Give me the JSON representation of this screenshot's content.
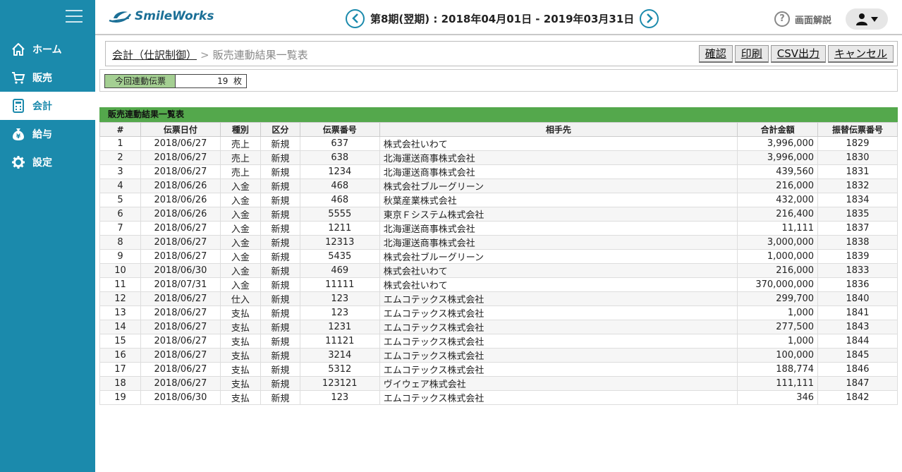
{
  "app": {
    "logo_text": "SmileWorks"
  },
  "header": {
    "period": "第8期(翌期) : 2018年04月01日 - 2019年03月31日",
    "help_label": "画面解説",
    "help_mark": "?"
  },
  "sidebar": {
    "items": [
      {
        "label": "ホーム",
        "icon": "home-icon"
      },
      {
        "label": "販売",
        "icon": "cart-icon"
      },
      {
        "label": "会計",
        "icon": "calculator-icon",
        "active": true
      },
      {
        "label": "給与",
        "icon": "yen-bag-icon"
      },
      {
        "label": "設定",
        "icon": "gear-icon"
      }
    ]
  },
  "breadcrumb": {
    "parent": "会計（仕訳制御）",
    "separator": ">",
    "current": "販売連動結果一覧表"
  },
  "toolbar": {
    "confirm": "確認",
    "print": "印刷",
    "csv": "CSV出力",
    "cancel": "キャンセル"
  },
  "count": {
    "label": "今回連動伝票",
    "value": "19",
    "unit": "枚"
  },
  "table": {
    "title": "販売連動結果一覧表",
    "headers": [
      "#",
      "伝票日付",
      "種別",
      "区分",
      "伝票番号",
      "相手先",
      "合計金額",
      "振替伝票番号"
    ],
    "rows": [
      [
        "1",
        "2018/06/27",
        "売上",
        "新規",
        "637",
        "株式会社いわて",
        "3,996,000",
        "1829"
      ],
      [
        "2",
        "2018/06/27",
        "売上",
        "新規",
        "638",
        "北海運送商事株式会社",
        "3,996,000",
        "1830"
      ],
      [
        "3",
        "2018/06/27",
        "売上",
        "新規",
        "1234",
        "北海運送商事株式会社",
        "439,560",
        "1831"
      ],
      [
        "4",
        "2018/06/26",
        "入金",
        "新規",
        "468",
        "株式会社ブルーグリーン",
        "216,000",
        "1832"
      ],
      [
        "5",
        "2018/06/26",
        "入金",
        "新規",
        "468",
        "秋葉産業株式会社",
        "432,000",
        "1834"
      ],
      [
        "6",
        "2018/06/26",
        "入金",
        "新規",
        "5555",
        "東京Ｆシステム株式会社",
        "216,400",
        "1835"
      ],
      [
        "7",
        "2018/06/27",
        "入金",
        "新規",
        "1211",
        "北海運送商事株式会社",
        "11,111",
        "1837"
      ],
      [
        "8",
        "2018/06/27",
        "入金",
        "新規",
        "12313",
        "北海運送商事株式会社",
        "3,000,000",
        "1838"
      ],
      [
        "9",
        "2018/06/27",
        "入金",
        "新規",
        "5435",
        "株式会社ブルーグリーン",
        "1,000,000",
        "1839"
      ],
      [
        "10",
        "2018/06/30",
        "入金",
        "新規",
        "469",
        "株式会社いわて",
        "216,000",
        "1833"
      ],
      [
        "11",
        "2018/07/31",
        "入金",
        "新規",
        "11111",
        "株式会社いわて",
        "370,000,000",
        "1836"
      ],
      [
        "12",
        "2018/06/27",
        "仕入",
        "新規",
        "123",
        "エムコテックス株式会社",
        "299,700",
        "1840"
      ],
      [
        "13",
        "2018/06/27",
        "支払",
        "新規",
        "123",
        "エムコテックス株式会社",
        "1,000",
        "1841"
      ],
      [
        "14",
        "2018/06/27",
        "支払",
        "新規",
        "1231",
        "エムコテックス株式会社",
        "277,500",
        "1843"
      ],
      [
        "15",
        "2018/06/27",
        "支払",
        "新規",
        "11121",
        "エムコテックス株式会社",
        "1,000",
        "1844"
      ],
      [
        "16",
        "2018/06/27",
        "支払",
        "新規",
        "3214",
        "エムコテックス株式会社",
        "100,000",
        "1845"
      ],
      [
        "17",
        "2018/06/27",
        "支払",
        "新規",
        "5312",
        "エムコテックス株式会社",
        "188,774",
        "1846"
      ],
      [
        "18",
        "2018/06/27",
        "支払",
        "新規",
        "123121",
        "ヴイウェア株式会社",
        "111,111",
        "1847"
      ],
      [
        "19",
        "2018/06/30",
        "支払",
        "新規",
        "123",
        "エムコテックス株式会社",
        "346",
        "1842"
      ]
    ]
  },
  "colors": {
    "sidebar": "#1b8aac",
    "table_title": "#54a84c",
    "count_label": "#a4cf92"
  }
}
